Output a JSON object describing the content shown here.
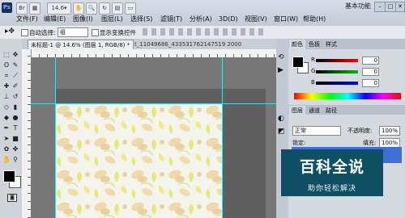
{
  "app": {
    "logo_text": "Ps",
    "zoom": "14.6",
    "workspace": "基本功能"
  },
  "menu": [
    {
      "label": "文件(F)"
    },
    {
      "label": "编辑(E)"
    },
    {
      "label": "图像(I)"
    },
    {
      "label": "图层(L)"
    },
    {
      "label": "选择(S)"
    },
    {
      "label": "滤镜(T)"
    },
    {
      "label": "分析(A)"
    },
    {
      "label": "3D(D)"
    },
    {
      "label": "视图(V)"
    },
    {
      "label": "窗口(W)"
    },
    {
      "label": "帮助(H)"
    }
  ],
  "options": {
    "auto_select_label": "自动选择:",
    "auto_select_value": "组",
    "show_transform_label": "显示变换控件"
  },
  "documents": {
    "active_tab": "未标题-1 @ 14.6% (图层 1, RGB/8) *",
    "second_tab": "t_11049686_433531762147519 2000"
  },
  "color_panel": {
    "tabs": [
      "颜色",
      "色板",
      "样式"
    ],
    "channels": [
      {
        "label": "R",
        "value": "0"
      },
      {
        "label": "G",
        "value": "0"
      },
      {
        "label": "B",
        "value": "0"
      }
    ]
  },
  "layers_panel": {
    "tabs": [
      "图层",
      "通道",
      "路径"
    ],
    "blend_mode": "正常",
    "opacity_label": "不透明度:",
    "opacity_value": "100%",
    "lock_label": "锁定:",
    "fill_label": "填充:",
    "fill_value": "100%"
  },
  "watermark": {
    "title": "百科全说",
    "subtitle": "助你轻松解决"
  },
  "colors": {
    "accent": "#3d6fd6",
    "watermark_bg": "#0f4f63",
    "guide": "#4fd8e0"
  }
}
